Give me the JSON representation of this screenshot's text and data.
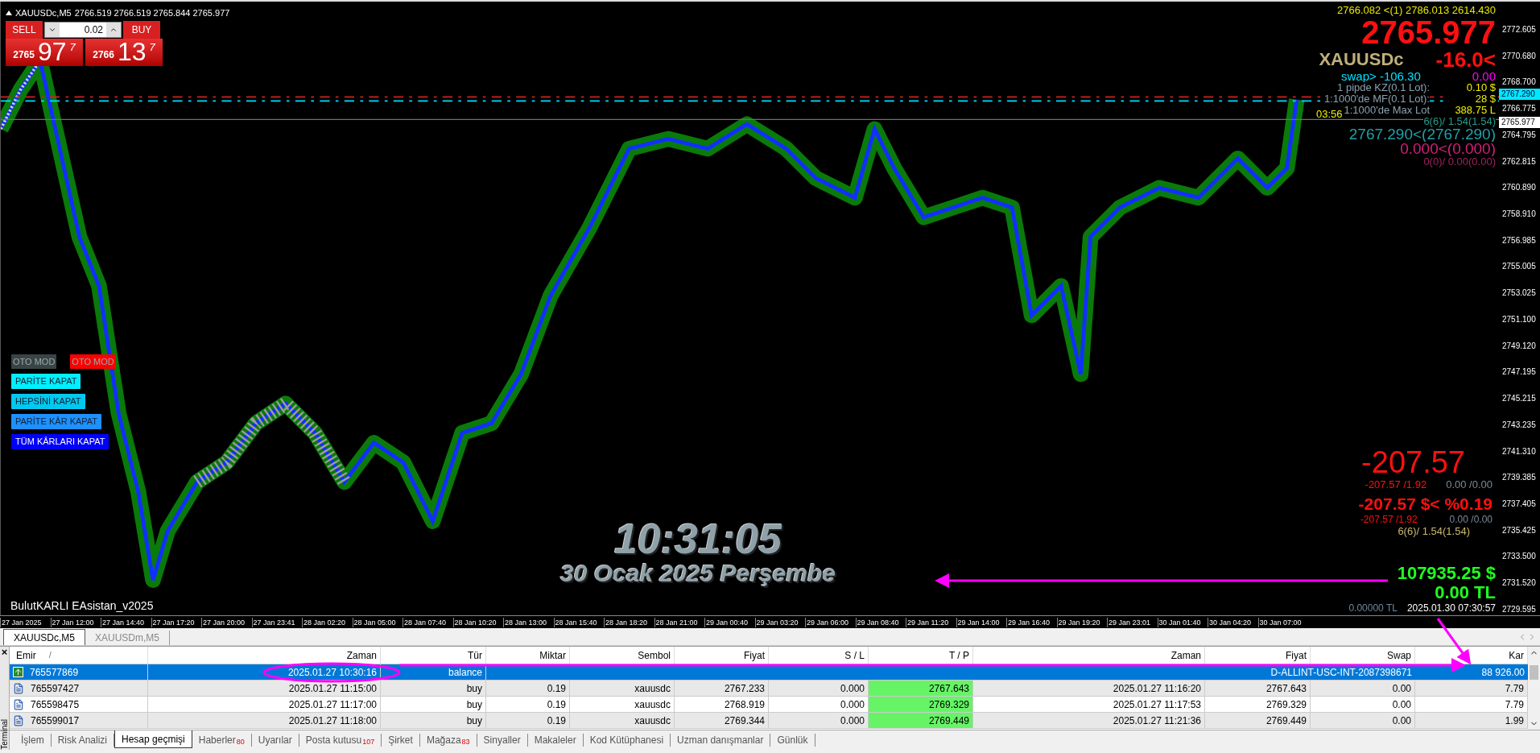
{
  "chart": {
    "header": {
      "symbol": "XAUUSDc,M5",
      "ohlc": "2766.519 2766.519 2765.844 2765.977"
    },
    "trade_panel": {
      "sell_label": "SELL",
      "buy_label": "BUY",
      "lot": "0.02",
      "sell_price": {
        "head": "2765",
        "main": "97",
        "tail": "7"
      },
      "buy_price": {
        "head": "2766",
        "main": "13",
        "tail": "7"
      }
    },
    "info_top": {
      "quote_line": "2766.082 <(1) 2786.013 2614.430",
      "price": "2765.977",
      "symbol": "XAUUSDc",
      "change": "-16.0<",
      "swap": "swap> -106.30",
      "swap_value": "0.00",
      "rows": [
        {
          "label": "1 pipde KZ(0.1 Lot):",
          "value": "0.10 $"
        },
        {
          "label": "1:1000'de MF(0.1 Lot):",
          "value": "28 $"
        },
        {
          "label": "1:1000'de Max Lot",
          "value": "388.75 L"
        }
      ],
      "buy_positions": "6(6)/ 1.54(1.54)",
      "buy_average": "2767.290<(2767.290)",
      "sell_average": "0.000<(0.000)",
      "sell_positions": "0(0)/ 0.00(0.00)"
    },
    "countdown": "03:56",
    "buttons": [
      {
        "label": "OTO MOD",
        "color": "#3a4446"
      },
      {
        "label": "OTO MOD",
        "color": "#ff0000"
      },
      {
        "label": "PARİTE KAPAT",
        "color": "#00f0ff"
      },
      {
        "label": "HEPSİNİ KAPAT",
        "color": "#00c8f0"
      },
      {
        "label": "PARİTE KÂR KAPAT",
        "color": "#1e90ff"
      },
      {
        "label": "TÜM KÂRLARI KAPAT",
        "color": "#0000ff"
      }
    ],
    "clock": {
      "time": "10:31:05",
      "date": "30 Ocak 2025 Perşembe"
    },
    "ea_name": "BulutKARLI EAsistan_v2025",
    "pnl": {
      "total": "-207.57",
      "buy_line": "-207.57 /1.92",
      "sell_line": "0.00 /0.00",
      "total_percent": "-207.57 $< %0.19",
      "buy_line_2": "-207.57 /1.92",
      "sell_line_2": "0.00 /0.00",
      "positions": "6(6)/ 1.54(1.54)"
    },
    "balance": {
      "usd": "107935.25 $",
      "tl": "0.00 TL",
      "rate": "0.00000 TL",
      "datetime": "2025.01.30 07:30:57"
    },
    "price_axis": [
      "2772.605",
      "2770.680",
      "2768.700",
      "2766.775",
      "2764.795",
      "2762.815",
      "2760.890",
      "2758.910",
      "2756.985",
      "2755.005",
      "2753.025",
      "2751.100",
      "2749.120",
      "2747.195",
      "2745.215",
      "2743.235",
      "2741.310",
      "2739.385",
      "2737.405",
      "2735.425",
      "2733.500",
      "2731.520",
      "2729.595"
    ],
    "price_tags": [
      {
        "label": "2767.290",
        "kind": "ask"
      },
      {
        "label": "2765.977",
        "kind": "bid"
      }
    ],
    "time_axis": [
      "27 Jan 2025",
      "27 Jan 12:00",
      "27 Jan 14:40",
      "27 Jan 17:20",
      "27 Jan 20:00",
      "27 Jan 23:41",
      "28 Jan 02:20",
      "28 Jan 05:00",
      "28 Jan 07:40",
      "28 Jan 10:20",
      "28 Jan 13:00",
      "28 Jan 15:40",
      "28 Jan 18:20",
      "28 Jan 21:00",
      "29 Jan 00:40",
      "29 Jan 03:20",
      "29 Jan 06:00",
      "29 Jan 08:40",
      "29 Jan 11:20",
      "29 Jan 14:00",
      "29 Jan 16:40",
      "29 Jan 19:20",
      "29 Jan 23:01",
      "30 Jan 01:40",
      "30 Jan 04:20",
      "30 Jan 07:00"
    ]
  },
  "chart_tabs": [
    {
      "label": "XAUUSDc,M5",
      "selected": true
    },
    {
      "label": "XAUUSDm,M5",
      "selected": false
    }
  ],
  "terminal": {
    "title": "Terminal",
    "close": "×",
    "columns": [
      "Emir",
      "Zaman",
      "Tür",
      "Miktar",
      "Sembol",
      "Fiyat",
      "S / L",
      "T / P",
      "Zaman",
      "Fiyat",
      "Swap",
      "Kar"
    ],
    "sort_mark": "/",
    "rows": [
      {
        "kind": "balance",
        "selected": true,
        "cells": [
          "765577869",
          "2025.01.27 10:30:16",
          "balance"
        ],
        "comment": "D-ALLINT-USC-INT-2087398671",
        "profit": "88 926.00"
      },
      {
        "kind": "trade",
        "selected": false,
        "cells": [
          "765597427",
          "2025.01.27 11:15:00",
          "buy",
          "0.19",
          "xauusdc",
          "2767.233",
          "0.000",
          "2767.643",
          "2025.01.27 11:16:20",
          "2767.643",
          "0.00",
          "7.79"
        ]
      },
      {
        "kind": "trade",
        "selected": false,
        "cells": [
          "765598475",
          "2025.01.27 11:17:00",
          "buy",
          "0.19",
          "xauusdc",
          "2768.919",
          "0.000",
          "2769.329",
          "2025.01.27 11:17:53",
          "2769.329",
          "0.00",
          "7.79"
        ]
      },
      {
        "kind": "trade",
        "selected": false,
        "cells": [
          "765599017",
          "2025.01.27 11:18:00",
          "buy",
          "0.19",
          "xauusdc",
          "2769.344",
          "0.000",
          "2769.449",
          "2025.01.27 11:21:36",
          "2769.449",
          "0.00",
          "1.99"
        ]
      }
    ],
    "tabs": [
      {
        "label": "İşlem",
        "selected": false
      },
      {
        "label": "Risk Analizi",
        "selected": false
      },
      {
        "label": "Hesap geçmişi",
        "selected": true
      },
      {
        "label": "Haberler",
        "badge": "80",
        "selected": false
      },
      {
        "label": "Uyarılar",
        "selected": false
      },
      {
        "label": "Posta kutusu",
        "badge": "107",
        "selected": false
      },
      {
        "label": "Şirket",
        "selected": false
      },
      {
        "label": "Mağaza",
        "badge": "83",
        "selected": false
      },
      {
        "label": "Sinyaller",
        "selected": false
      },
      {
        "label": "Makaleler",
        "selected": false
      },
      {
        "label": "Kod Kütüphanesi",
        "selected": false
      },
      {
        "label": "Uzman danışmanlar",
        "selected": false
      },
      {
        "label": "Günlük",
        "selected": false
      }
    ]
  }
}
